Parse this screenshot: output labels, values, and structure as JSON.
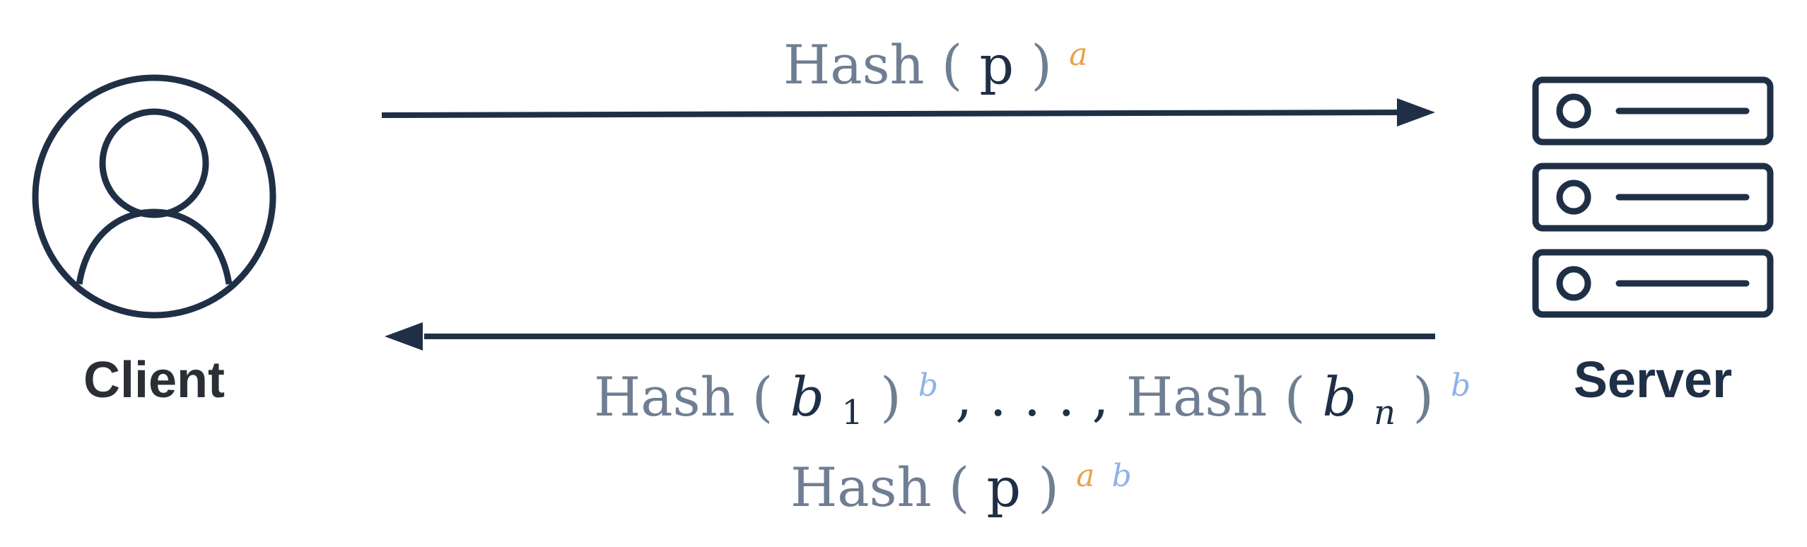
{
  "diagram": {
    "client_label": "Client",
    "server_label": "Server",
    "top_message": {
      "hash": "Hash",
      "open": "(",
      "arg": "p",
      "close": ")",
      "exp": "a"
    },
    "bottom_messages": {
      "line1": {
        "hash1": "Hash",
        "open1": "(",
        "b1": "b",
        "sub1": "1",
        "close1": ")",
        "exp1": "b",
        "sep": ", . . . ,",
        "hash2": "Hash",
        "open2": "(",
        "b2": "b",
        "sub2": "n",
        "close2": ")",
        "exp2": "b"
      },
      "line2": {
        "hash": "Hash",
        "open": "(",
        "arg": "p",
        "close": ")",
        "exp_a": "a",
        "exp_b": "b"
      }
    },
    "colors": {
      "navy": "#1f2f46",
      "gray": "#6f7e92",
      "orange": "#e6a24a",
      "blue": "#8eb3ea"
    },
    "icons": {
      "client": "user-circle-icon",
      "server": "server-rack-icon"
    }
  }
}
